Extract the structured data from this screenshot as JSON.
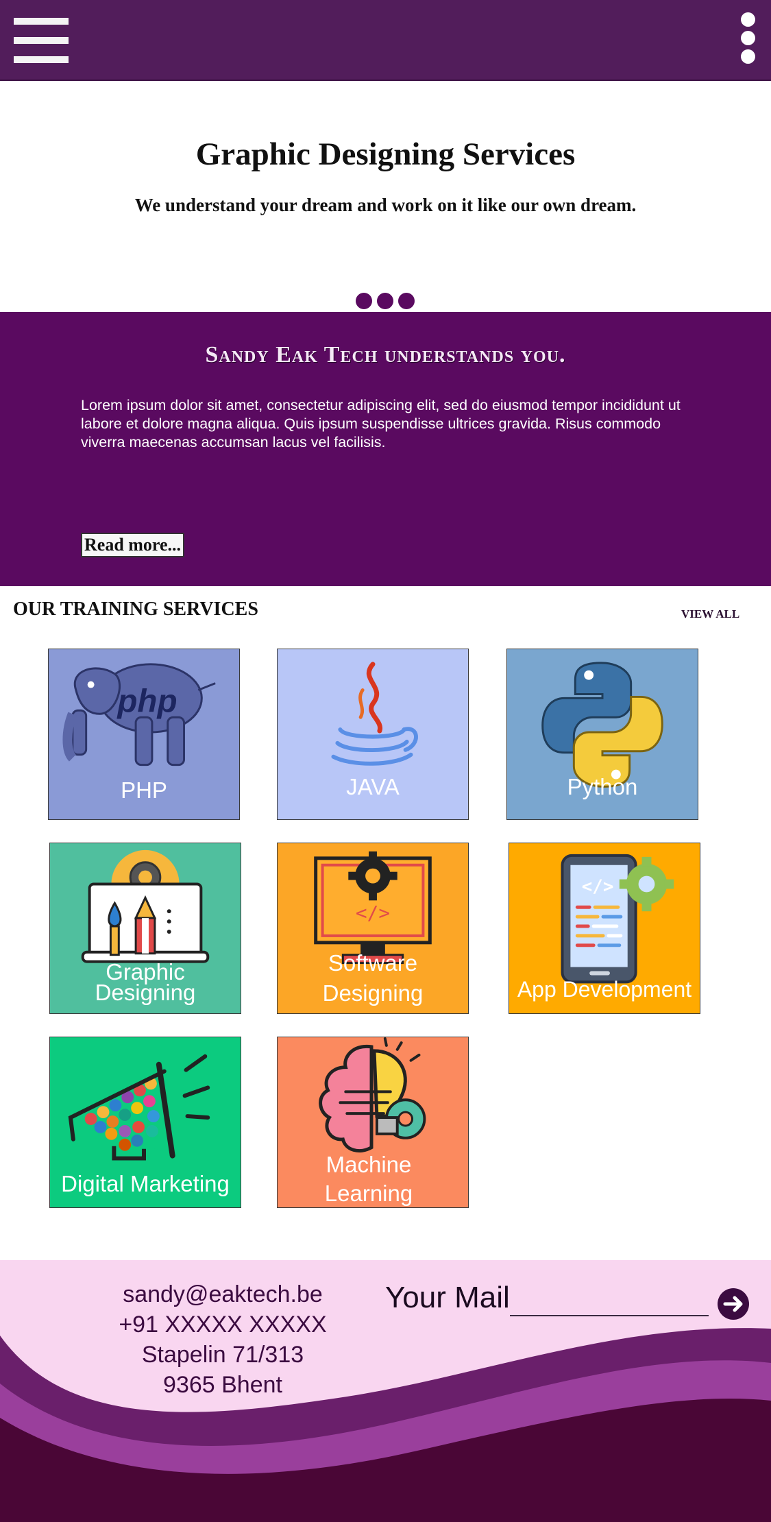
{
  "header": {
    "menu_icon": "hamburger-menu-icon",
    "more_icon": "kebab-vertical-icon",
    "bg_color": "#521d5b"
  },
  "hero": {
    "title": "Graphic Designing Services",
    "subtitle": "We understand your dream and work on it like our own dream.",
    "slide_count": 3
  },
  "about": {
    "heading": "Sandy Eak Tech understands you.",
    "body": "Lorem ipsum dolor sit amet, consectetur adipiscing elit, sed do eiusmod tempor incididunt ut labore et dolore magna aliqua. Quis ipsum suspendisse ultrices gravida. Risus commodo viverra maecenas accumsan lacus vel facilisis.",
    "read_more": "Read more...",
    "bg_color": "#5a0a60"
  },
  "services": {
    "title": "OUR TRAINING SERVICES",
    "view_all": "VIEW ALL",
    "items": [
      {
        "label": "PHP",
        "icon": "php-elephant-icon",
        "color": "#8a9ad6"
      },
      {
        "label": "JAVA",
        "icon": "java-coffee-cup-icon",
        "color": "#b8c6f7"
      },
      {
        "label": "Python",
        "icon": "python-logo-icon",
        "color": "#7aa6cf"
      },
      {
        "label": "Graphic\nDesigning",
        "icon": "design-tools-laptop-icon",
        "color": "#50bf9e"
      },
      {
        "label": "Software\nDesigning",
        "icon": "monitor-gear-code-icon",
        "color": "#fca626"
      },
      {
        "label": "App Development",
        "icon": "mobile-app-gear-icon",
        "color": "#ffaa00"
      },
      {
        "label": "Digital Marketing",
        "icon": "megaphone-social-icon",
        "color": "#0ccb7f"
      },
      {
        "label": "Machine\nLearning",
        "icon": "brain-bulb-gear-icon",
        "color": "#fb8a5f"
      }
    ]
  },
  "footer": {
    "email": "sandy@eaktech.be",
    "phone": "+91 XXXXX XXXXX",
    "address_line1": "Stapelin 71/313",
    "address_line2": "9365 Bhent",
    "mail_label": "Your Mail",
    "submit_icon": "arrow-right-circle-icon",
    "bg_color": "#f9d6f0"
  }
}
